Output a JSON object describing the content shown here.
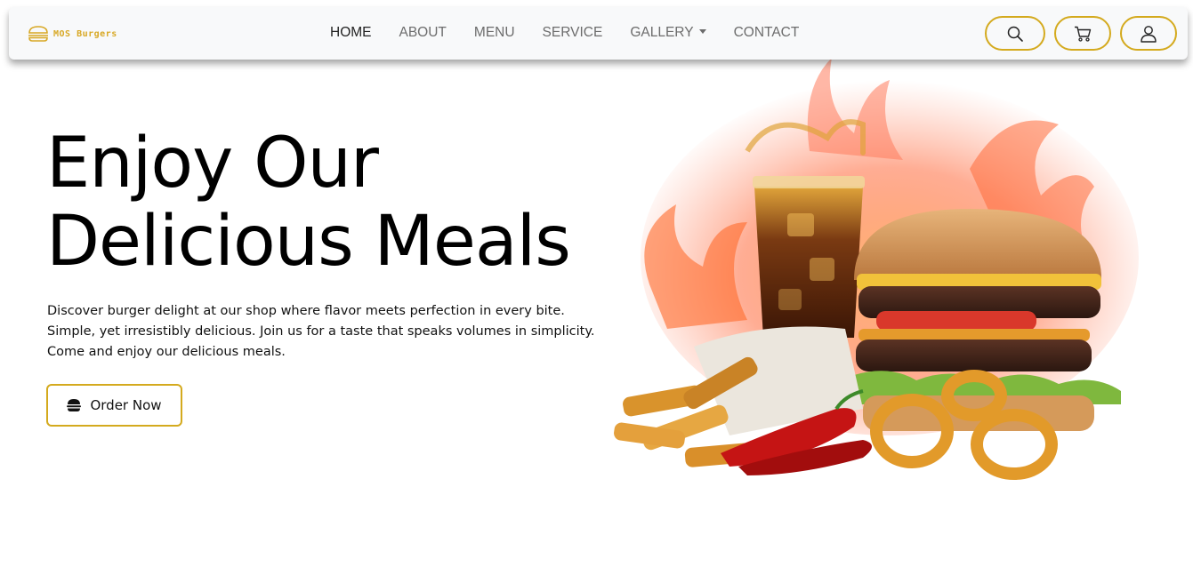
{
  "brand": {
    "name": "MOS Burgers",
    "accent": "#d8a824"
  },
  "nav": {
    "items": [
      {
        "label": "HOME",
        "active": true
      },
      {
        "label": "ABOUT",
        "active": false
      },
      {
        "label": "MENU",
        "active": false
      },
      {
        "label": "SERVICE",
        "active": false
      },
      {
        "label": "GALLERY",
        "active": false,
        "dropdown": true
      },
      {
        "label": "CONTACT",
        "active": false
      }
    ],
    "actions": [
      {
        "name": "search",
        "icon": "search-icon"
      },
      {
        "name": "cart",
        "icon": "cart-icon"
      },
      {
        "name": "account",
        "icon": "user-icon"
      }
    ],
    "border_color": "#d4aa1e"
  },
  "hero": {
    "title_line1": "Enjoy Our",
    "title_line2": "Delicious Meals",
    "desc_line1": "Discover burger delight at our shop where flavor meets perfection in every bite.",
    "desc_line2": "Simple, yet irresistibly delicious. Join us for a taste that speaks volumes in simplicity.",
    "desc_line3": "Come and enjoy our delicious meals.",
    "cta_label": "Order Now",
    "cta_icon": "burger-icon"
  }
}
